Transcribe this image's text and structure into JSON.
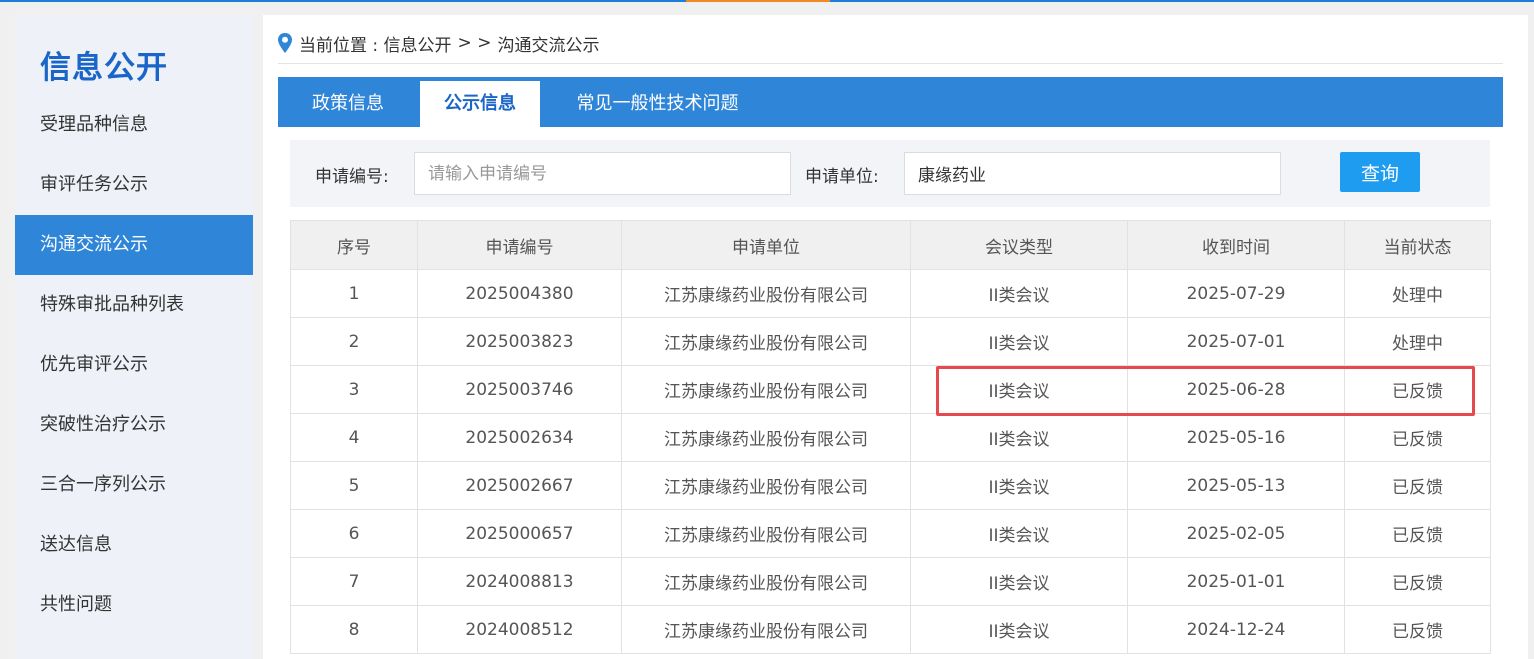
{
  "sidebar": {
    "title": "信息公开",
    "items": [
      {
        "label": "受理品种信息",
        "active": false
      },
      {
        "label": "审评任务公示",
        "active": false
      },
      {
        "label": "沟通交流公示",
        "active": true
      },
      {
        "label": "特殊审批品种列表",
        "active": false
      },
      {
        "label": "优先审评公示",
        "active": false
      },
      {
        "label": "突破性治疗公示",
        "active": false
      },
      {
        "label": "三合一序列公示",
        "active": false
      },
      {
        "label": "送达信息",
        "active": false
      },
      {
        "label": "共性问题",
        "active": false
      }
    ]
  },
  "breadcrumb": {
    "prefix": "当前位置 : 信息公开",
    "separator": "> >",
    "current": "沟通交流公示"
  },
  "tabs": [
    {
      "label": "政策信息",
      "active": false
    },
    {
      "label": "公示信息",
      "active": true
    },
    {
      "label": "常见一般性技术问题",
      "active": false
    }
  ],
  "search": {
    "app_no_label": "申请编号:",
    "app_no_placeholder": "请输入申请编号",
    "app_no_value": "",
    "unit_label": "申请单位:",
    "unit_value": "康缘药业",
    "button_label": "查询"
  },
  "table": {
    "headers": [
      "序号",
      "申请编号",
      "申请单位",
      "会议类型",
      "收到时间",
      "当前状态"
    ],
    "rows": [
      [
        "1",
        "2025004380",
        "江苏康缘药业股份有限公司",
        "II类会议",
        "2025-07-29",
        "处理中"
      ],
      [
        "2",
        "2025003823",
        "江苏康缘药业股份有限公司",
        "II类会议",
        "2025-07-01",
        "处理中"
      ],
      [
        "3",
        "2025003746",
        "江苏康缘药业股份有限公司",
        "II类会议",
        "2025-06-28",
        "已反馈"
      ],
      [
        "4",
        "2025002634",
        "江苏康缘药业股份有限公司",
        "II类会议",
        "2025-05-16",
        "已反馈"
      ],
      [
        "5",
        "2025002667",
        "江苏康缘药业股份有限公司",
        "II类会议",
        "2025-05-13",
        "已反馈"
      ],
      [
        "6",
        "2025000657",
        "江苏康缘药业股份有限公司",
        "II类会议",
        "2025-02-05",
        "已反馈"
      ],
      [
        "7",
        "2024008813",
        "江苏康缘药业股份有限公司",
        "II类会议",
        "2025-01-01",
        "已反馈"
      ],
      [
        "8",
        "2024008512",
        "江苏康缘药业股份有限公司",
        "II类会议",
        "2024-12-24",
        "已反馈"
      ]
    ]
  },
  "colors": {
    "primary": "#2f86d8",
    "accent": "#f08a24",
    "button": "#1e9cf0",
    "highlight": "#e5484d"
  },
  "icons": {
    "location": "location-pin-icon"
  }
}
